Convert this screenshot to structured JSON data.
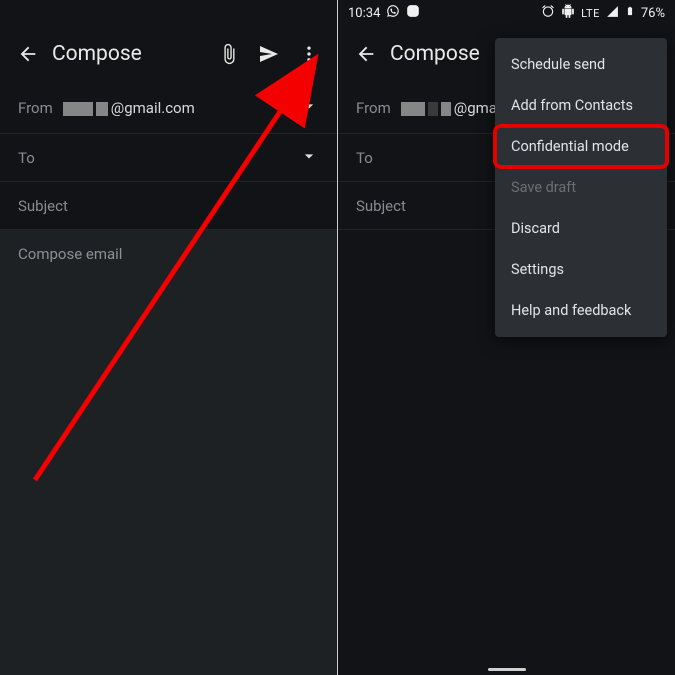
{
  "left": {
    "toolbar": {
      "title": "Compose"
    },
    "from": {
      "label": "From",
      "email": "@gmail.com"
    },
    "to": {
      "label": "To"
    },
    "subject": {
      "label": "Subject"
    },
    "body": {
      "placeholder": "Compose email"
    }
  },
  "right": {
    "status": {
      "time": "10:34",
      "lte": "LTE",
      "battery": "76%"
    },
    "toolbar": {
      "title": "Compose"
    },
    "from": {
      "label": "From",
      "email": "@gmai"
    },
    "to": {
      "label": "To"
    },
    "subject": {
      "label": "Subject"
    },
    "menu": {
      "schedule": "Schedule send",
      "contacts": "Add from Contacts",
      "confidential": "Confidential mode",
      "savedraft": "Save draft",
      "discard": "Discard",
      "settings": "Settings",
      "help": "Help and feedback"
    }
  }
}
